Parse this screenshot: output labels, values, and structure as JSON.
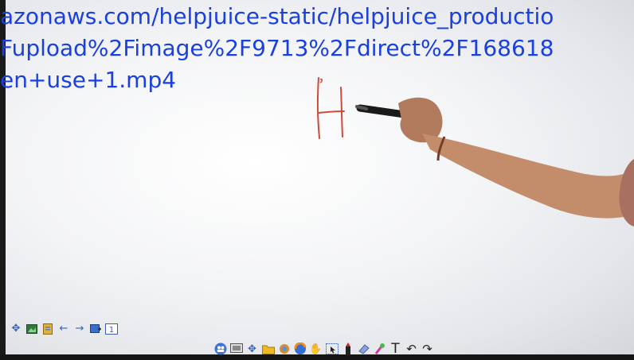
{
  "overlay_url": {
    "line1": "azonaws.com/helpjuice-static/helpjuice_productio",
    "line2": "Fupload%2Fimage%2F9713%2Fdirect%2F168618",
    "line3": "en+use+1.mp4"
  },
  "whiteboard": {
    "drawn_letter": "H",
    "ink_color": "#d04a3c"
  },
  "left_toolbar": {
    "icons": [
      "move-icon",
      "image-icon",
      "file-icon",
      "back-arrow-icon",
      "forward-arrow-icon",
      "add-page-icon",
      "page-number-icon"
    ],
    "page_number": "1"
  },
  "bottom_toolbar": {
    "icons": [
      "users-icon",
      "screen-icon",
      "move-icon",
      "folder-icon",
      "gear-icon",
      "browser-icon",
      "hand-icon",
      "select-icon",
      "pen-icon",
      "eraser-icon",
      "brush-icon",
      "text-icon",
      "undo-icon",
      "redo-icon"
    ],
    "text_tool_label": "T"
  },
  "colors": {
    "url_text": "#1a3fe0",
    "board_background": "#f3f4f6",
    "toolbar_accent": "#3a5fb5"
  }
}
